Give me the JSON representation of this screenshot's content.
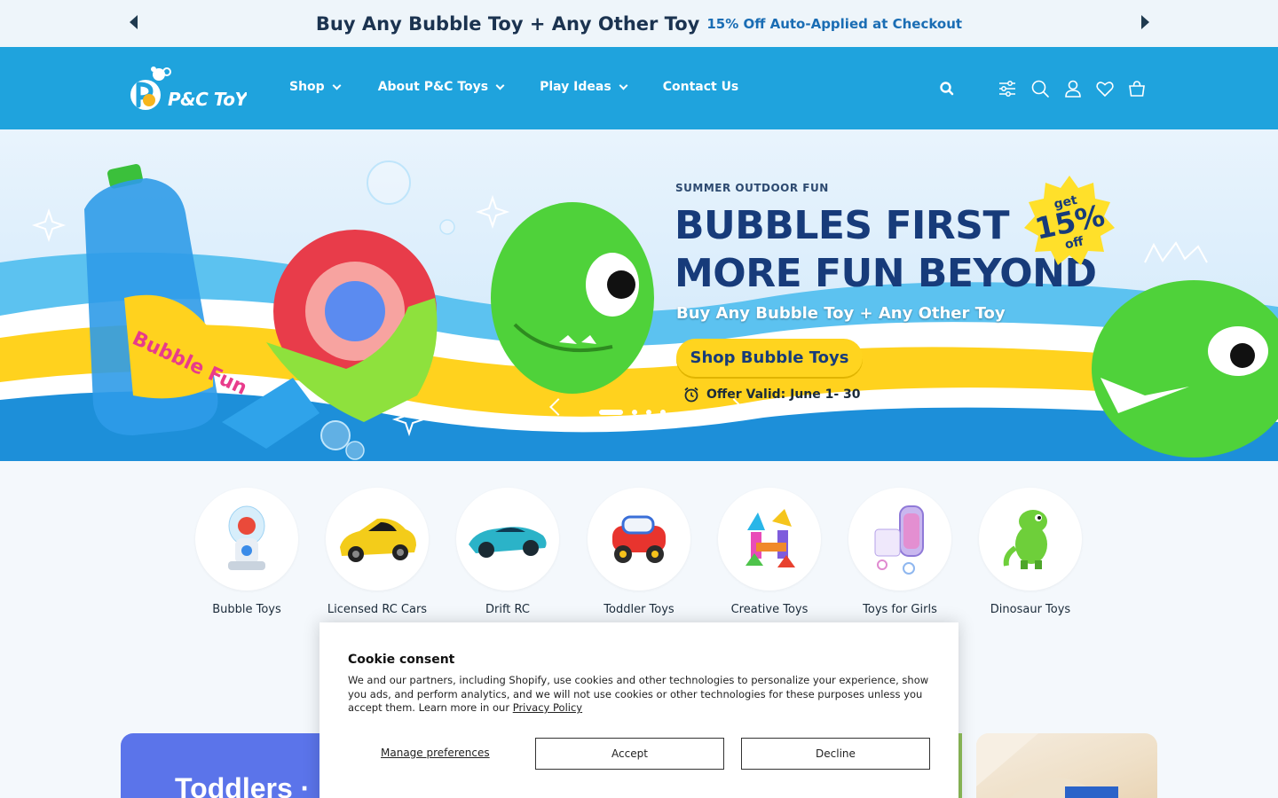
{
  "announcement": {
    "main": "Buy Any Bubble Toy + Any Other Toy",
    "sub": "15% Off Auto-Applied at Checkout"
  },
  "header": {
    "logo_text": "P&C ToYs",
    "nav": [
      {
        "label": "Shop",
        "has_dropdown": true
      },
      {
        "label": "About P&C Toys",
        "has_dropdown": true
      },
      {
        "label": "Play Ideas",
        "has_dropdown": true
      },
      {
        "label": "Contact Us",
        "has_dropdown": false
      }
    ],
    "icons": [
      "search-icon",
      "filter-icon",
      "search-icon",
      "account-icon",
      "wishlist-icon",
      "cart-icon"
    ]
  },
  "hero": {
    "kicker": "SUMMER OUTDOOR FUN",
    "title_line1": "BUBBLES FIRST",
    "title_line2": "MORE FUN BEYOND",
    "subtitle": "Buy Any Bubble Toy + Any Other Toy",
    "cta": "Shop Bubble Toys",
    "offer": "Offer Valid: June 1- 30",
    "badge_top": "get",
    "badge_main": "15%",
    "badge_bottom": "off",
    "bottle_label": "Bubble Fun",
    "slides_total": 4,
    "active_slide": 1
  },
  "categories": [
    {
      "label": "Bubble Toys"
    },
    {
      "label": "Licensed RC Cars"
    },
    {
      "label": "Drift RC"
    },
    {
      "label": "Toddler Toys"
    },
    {
      "label": "Creative Toys"
    },
    {
      "label": "Toys for Girls"
    },
    {
      "label": "Dinosaur Toys"
    }
  ],
  "cards": {
    "left_title": "Toddlers ·"
  },
  "cookie": {
    "title": "Cookie consent",
    "body": "We and our partners, including Shopify, use cookies and other technologies to personalize your experience, show you ads, and perform analytics, and we will not use cookies or other technologies for these purposes unless you accept them. Learn more in our ",
    "link": "Privacy Policy",
    "manage": "Manage preferences",
    "accept": "Accept",
    "decline": "Decline"
  },
  "colors": {
    "header_bg": "#1fa3dd",
    "announce_bg": "#eef5fa",
    "hero_title": "#173b7a",
    "cta_bg": "#ffd41f",
    "card_blue": "#5b74ea"
  }
}
